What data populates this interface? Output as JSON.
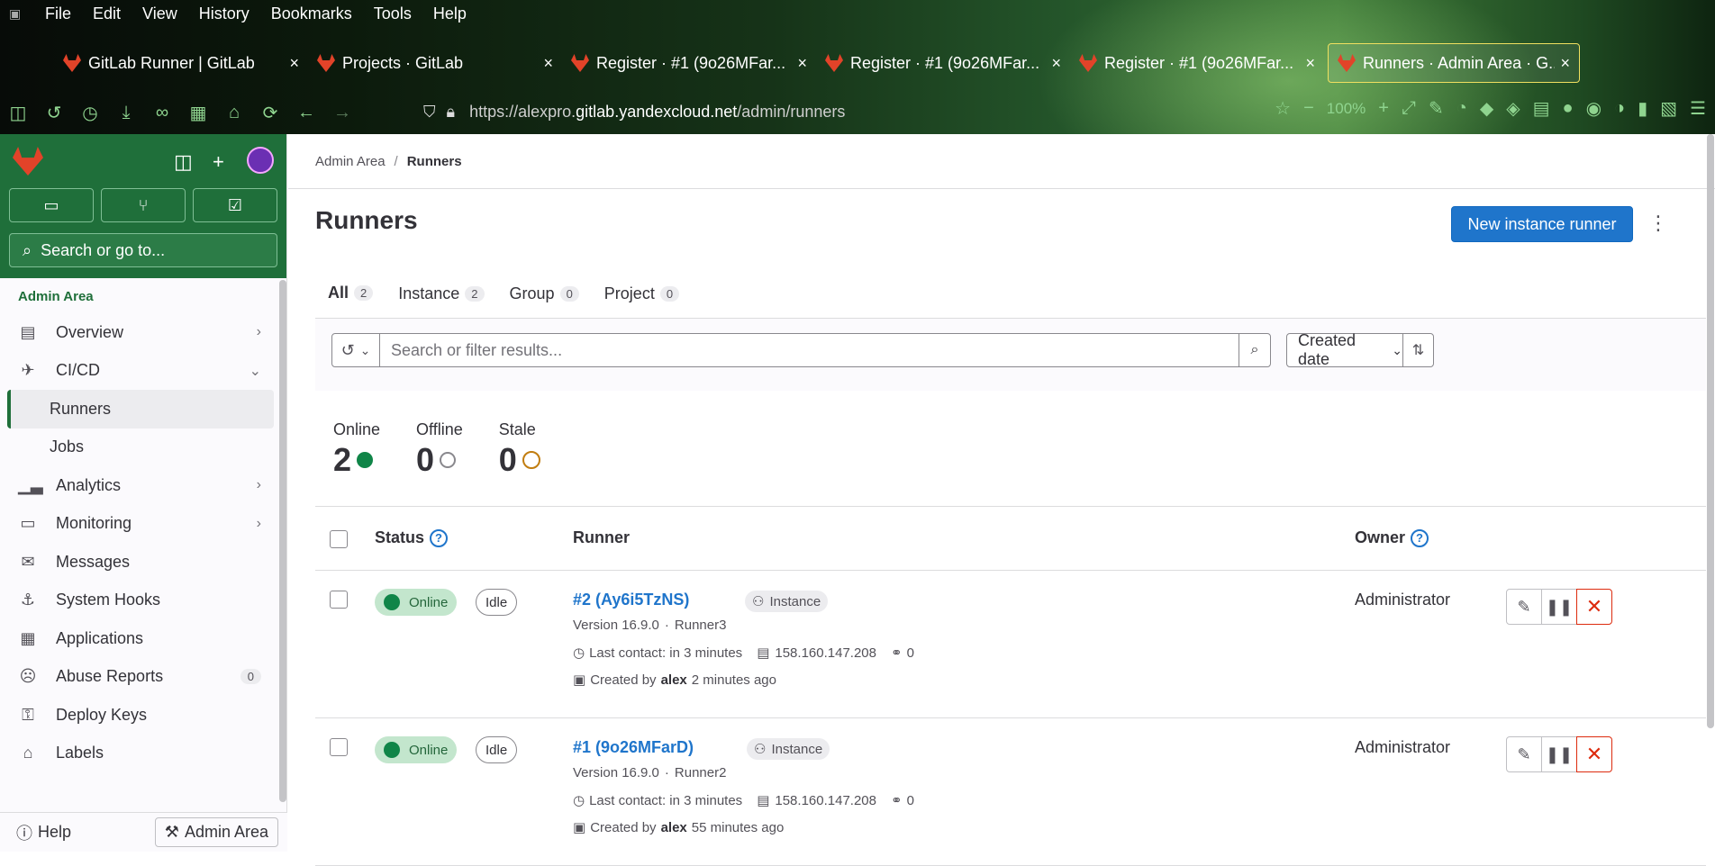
{
  "browser": {
    "menu": [
      "File",
      "Edit",
      "View",
      "History",
      "Bookmarks",
      "Tools",
      "Help"
    ],
    "tabs": [
      {
        "title": "GitLab Runner | GitLab"
      },
      {
        "title": "Projects · GitLab"
      },
      {
        "title": "Register · #1 (9o26MFar..."
      },
      {
        "title": "Register · #1 (9o26MFar..."
      },
      {
        "title": "Register · #1 (9o26MFar..."
      },
      {
        "title": "Runners · Admin Area · G..."
      }
    ],
    "url_prefix": "https://alexpro.",
    "url_domain": "gitlab.yandexcloud.net",
    "url_path": "/admin/runners",
    "zoom": "100%"
  },
  "sidebar": {
    "search_placeholder": "Search or go to...",
    "section": "Admin Area",
    "items": [
      {
        "label": "Overview",
        "icon": "overview-icon",
        "chevron": "›"
      },
      {
        "label": "CI/CD",
        "icon": "rocket-icon",
        "chevron": "⌄"
      },
      {
        "label": "Runners"
      },
      {
        "label": "Jobs"
      },
      {
        "label": "Analytics",
        "icon": "chart-icon",
        "chevron": "›"
      },
      {
        "label": "Monitoring",
        "icon": "monitor-icon",
        "chevron": "›"
      },
      {
        "label": "Messages",
        "icon": "messages-icon"
      },
      {
        "label": "System Hooks",
        "icon": "hook-icon"
      },
      {
        "label": "Applications",
        "icon": "applications-icon"
      },
      {
        "label": "Abuse Reports",
        "icon": "abuse-icon",
        "badge": "0"
      },
      {
        "label": "Deploy Keys",
        "icon": "key-icon"
      },
      {
        "label": "Labels",
        "icon": "label-icon"
      }
    ],
    "footer_help": "Help",
    "footer_admin": "Admin Area"
  },
  "main": {
    "breadcrumb_root": "Admin Area",
    "breadcrumb_current": "Runners",
    "title": "Runners",
    "new_button": "New instance runner",
    "tabs": [
      {
        "label": "All",
        "count": "2"
      },
      {
        "label": "Instance",
        "count": "2"
      },
      {
        "label": "Group",
        "count": "0"
      },
      {
        "label": "Project",
        "count": "0"
      }
    ],
    "filter_placeholder": "Search or filter results...",
    "sort_label": "Created date",
    "stats": [
      {
        "label": "Online",
        "value": "2"
      },
      {
        "label": "Offline",
        "value": "0"
      },
      {
        "label": "Stale",
        "value": "0"
      }
    ],
    "columns": {
      "status": "Status",
      "runner": "Runner",
      "owner": "Owner"
    },
    "runners": [
      {
        "status": "Online",
        "activity": "Idle",
        "name": "#2 (Ay6i5TzNS)",
        "type": "Instance",
        "version": "Version 16.9.0",
        "desc": "Runner3",
        "last_contact": "Last contact: in 3 minutes",
        "ip": "158.160.147.208",
        "jobs": "0",
        "created_by": "Created by",
        "author": "alex",
        "created_ago": "2 minutes ago",
        "owner": "Administrator"
      },
      {
        "status": "Online",
        "activity": "Idle",
        "name": "#1 (9o26MFarD)",
        "type": "Instance",
        "version": "Version 16.9.0",
        "desc": "Runner2",
        "last_contact": "Last contact: in 3 minutes",
        "ip": "158.160.147.208",
        "jobs": "0",
        "created_by": "Created by",
        "author": "alex",
        "created_ago": "55 minutes ago",
        "owner": "Administrator"
      }
    ]
  }
}
